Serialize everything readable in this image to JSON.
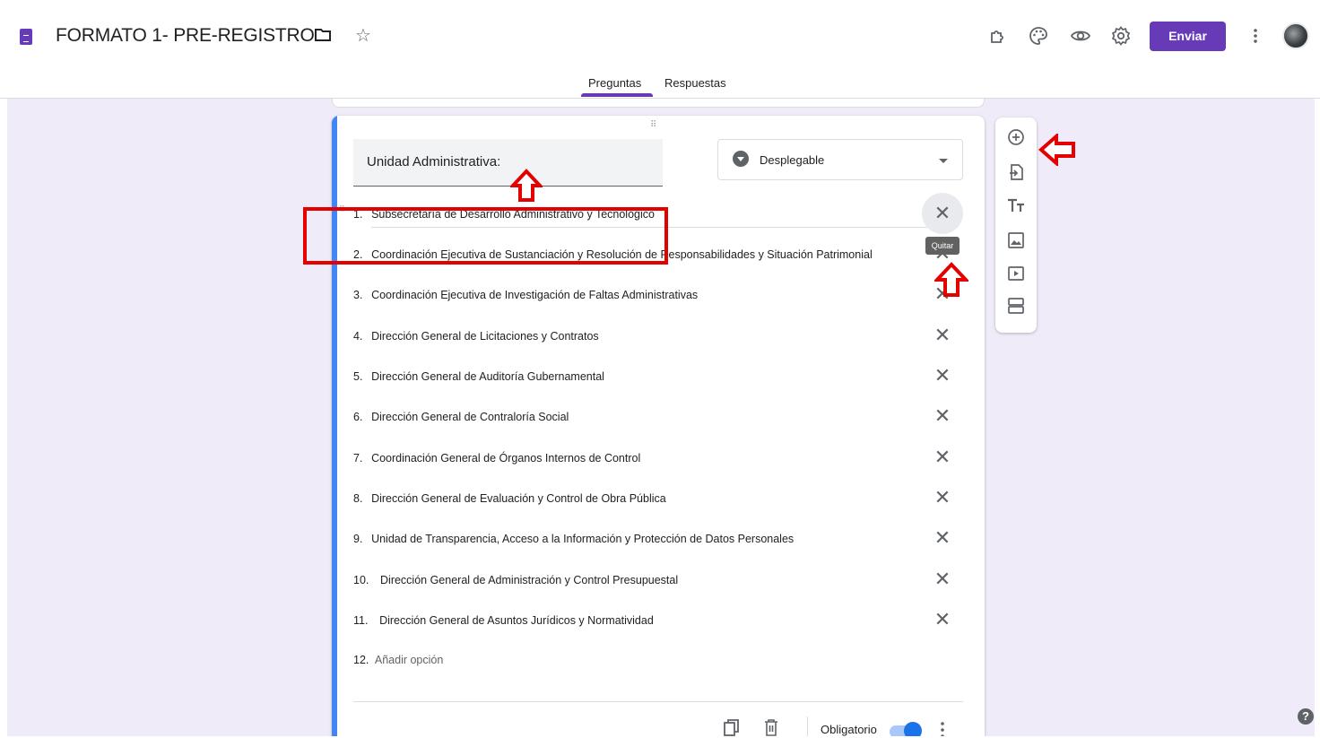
{
  "header": {
    "title": "FORMATO 1- PRE-REGISTRO",
    "send_label": "Enviar"
  },
  "tabs": [
    {
      "label": "Preguntas",
      "active": true
    },
    {
      "label": "Respuestas",
      "active": false
    }
  ],
  "question": {
    "title": "Unidad Administrativa:",
    "type": "Desplegable",
    "options": [
      {
        "num": "1.",
        "text": "Subsecretaría de Desarrollo Administrativo y Tecnológico"
      },
      {
        "num": "2.",
        "text": "Coordinación Ejecutiva de Sustanciación y Resolución de Responsabilidades y Situación Patrimonial"
      },
      {
        "num": "3.",
        "text": "Coordinación Ejecutiva de Investigación de Faltas Administrativas"
      },
      {
        "num": "4.",
        "text": "Dirección General de Licitaciones y Contratos"
      },
      {
        "num": "5.",
        "text": "Dirección General de Auditoría Gubernamental"
      },
      {
        "num": "6.",
        "text": "Dirección General de Contraloría Social"
      },
      {
        "num": "7.",
        "text": "Coordinación General de Órganos Internos de Control"
      },
      {
        "num": "8.",
        "text": "Dirección General de Evaluación y Control de Obra Pública"
      },
      {
        "num": "9.",
        "text": "Unidad de Transparencia, Acceso a la Información y Protección de Datos Personales"
      },
      {
        "num": "10.",
        "text": "Dirección General de Administración y Control Presupuestal"
      },
      {
        "num": "11.",
        "text": "Dirección General de Asuntos Jurídicos y Normatividad"
      }
    ],
    "add_option": {
      "num": "12.",
      "text": "Añadir opción"
    },
    "required_label": "Obligatorio",
    "required": true
  },
  "tooltip": "Quitar",
  "help_label": "?",
  "colors": {
    "brand": "#673ab7",
    "accent": "#4285f4",
    "background": "#f0ebf8",
    "annotation": "#e50000"
  },
  "icons": {
    "header": [
      "forms-doc-icon",
      "folder-icon",
      "star-icon",
      "addons-icon",
      "palette-icon",
      "preview-eye-icon",
      "settings-gear-icon",
      "more-vert-icon",
      "avatar"
    ],
    "side_toolbar": [
      "add-question-icon",
      "import-questions-icon",
      "add-title-icon",
      "add-image-icon",
      "add-video-icon",
      "add-section-icon"
    ],
    "footer": [
      "duplicate-icon",
      "delete-icon",
      "more-vert-icon"
    ]
  }
}
